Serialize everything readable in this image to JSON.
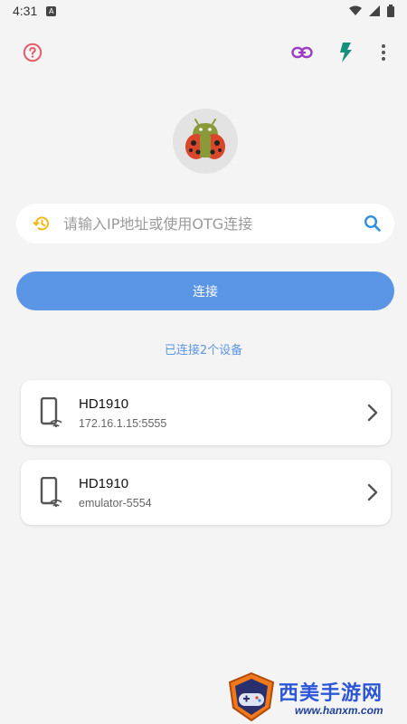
{
  "status_bar": {
    "time": "4:31",
    "notification_glyph": "A"
  },
  "toolbar": {
    "help_icon": "help-circle-icon",
    "link_icon": "link-icon",
    "flash_icon": "flash-icon",
    "more_icon": "more-vert-icon"
  },
  "search": {
    "value": "",
    "placeholder": "请输入IP地址或使用OTG连接"
  },
  "connect_button": {
    "label": "连接"
  },
  "connected_count_text": "已连接2个设备",
  "devices": [
    {
      "name": "HD1910",
      "address": "172.16.1.15:5555"
    },
    {
      "name": "HD1910",
      "address": "emulator-5554"
    }
  ],
  "watermark": {
    "title": "西美手游网",
    "url": "www.hanxm.com"
  },
  "colors": {
    "accent": "#5b95e6",
    "help": "#e95b6b",
    "link": "#9b3ec4",
    "flash": "#16907a",
    "history": "#f2b81c",
    "search": "#2f8fe0"
  }
}
